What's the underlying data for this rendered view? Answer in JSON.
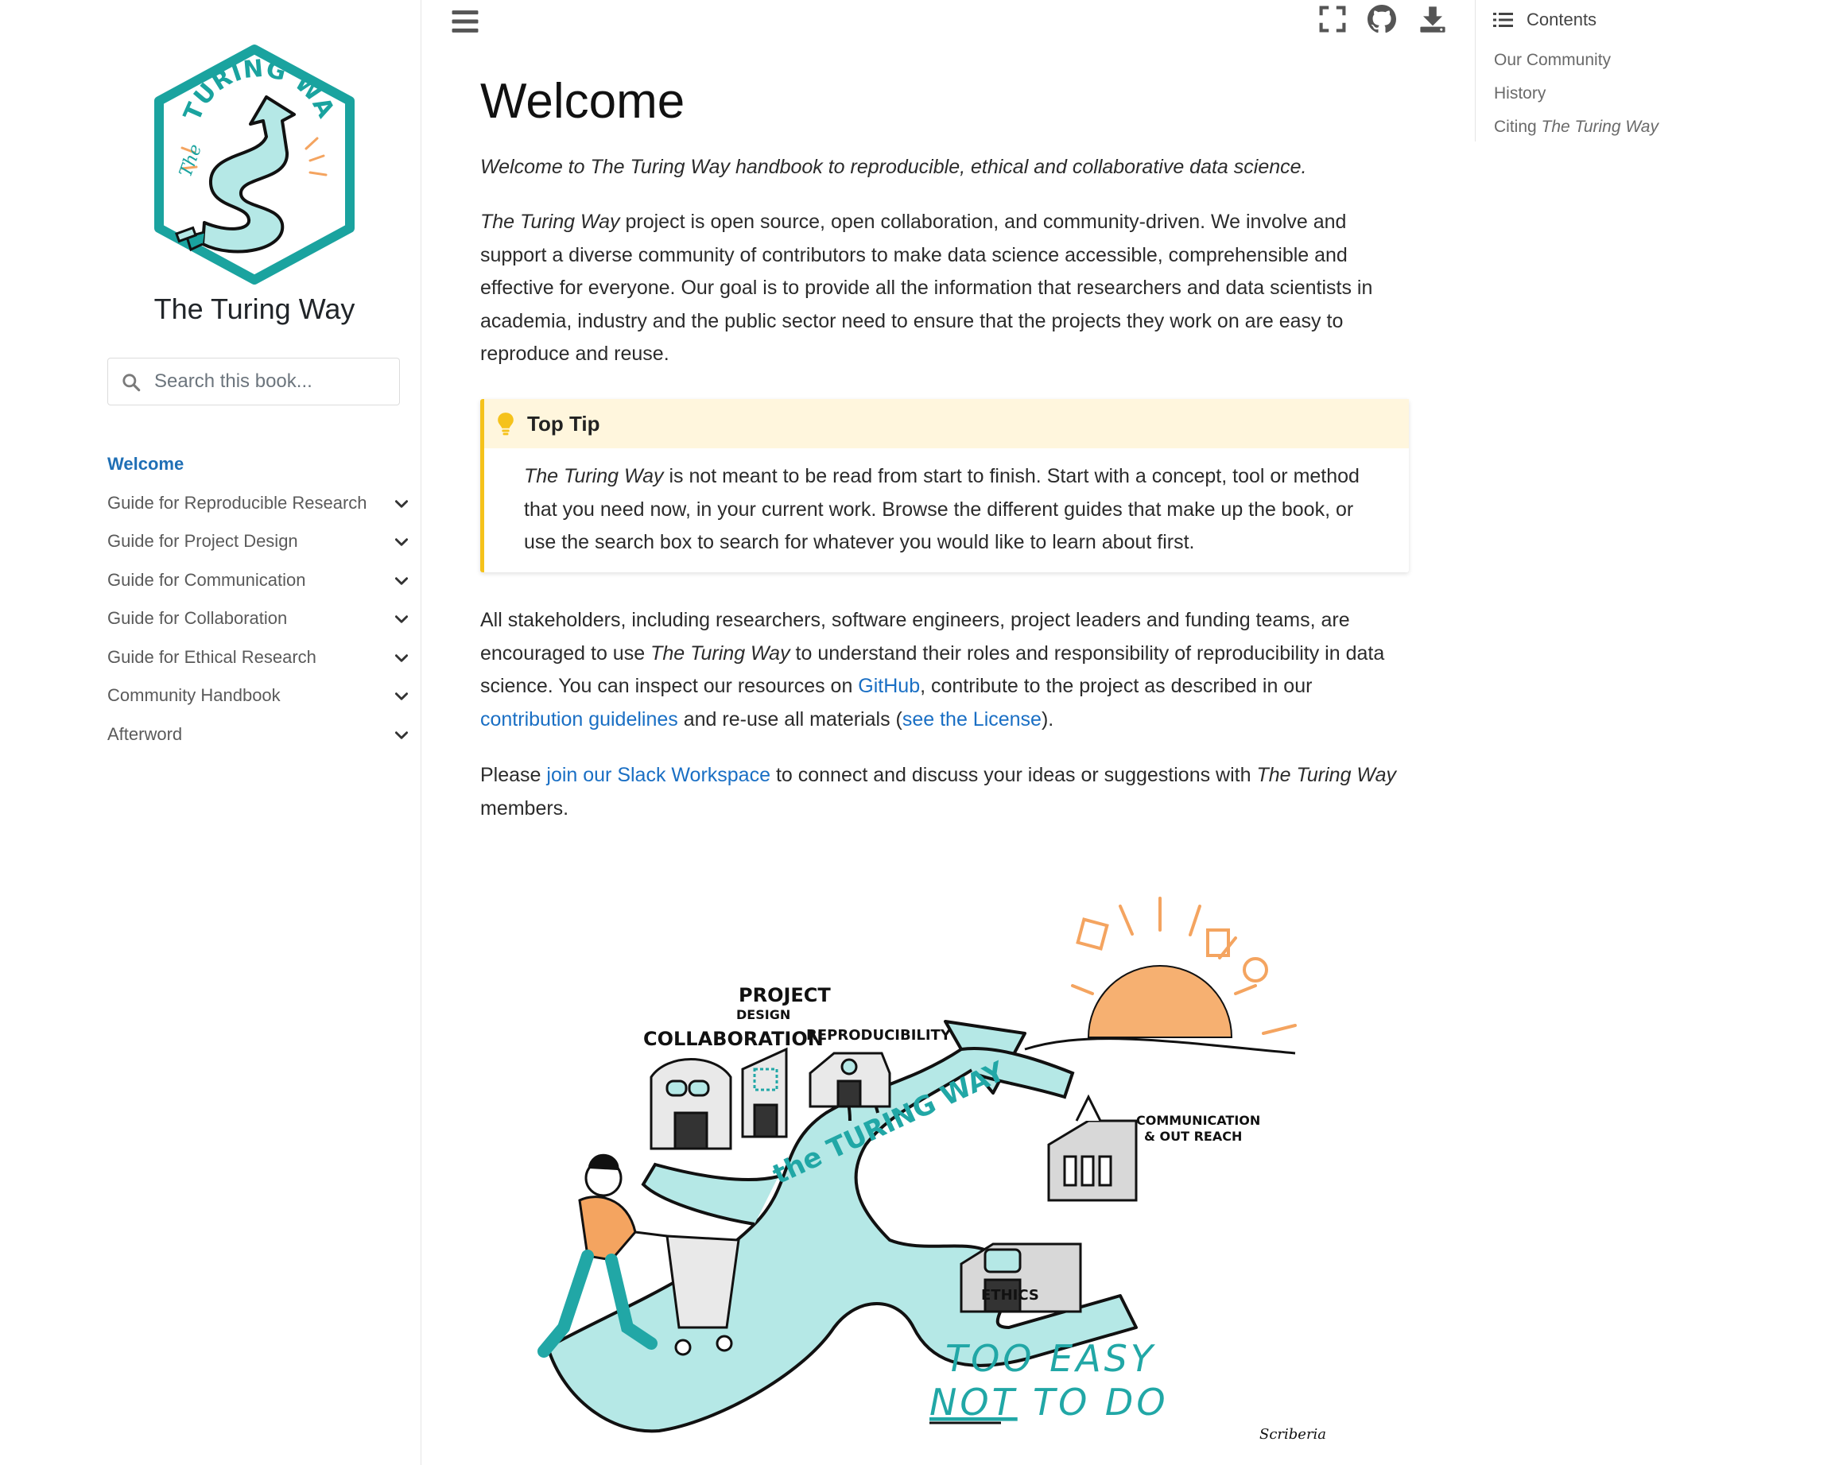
{
  "sidebar": {
    "site_title": "The Turing Way",
    "logo_alt": "The Turing Way",
    "search_placeholder": "Search this book...",
    "nav_items": [
      {
        "label": "Welcome",
        "active": true,
        "expandable": false
      },
      {
        "label": "Guide for Reproducible Research",
        "active": false,
        "expandable": true
      },
      {
        "label": "Guide for Project Design",
        "active": false,
        "expandable": true
      },
      {
        "label": "Guide for Communication",
        "active": false,
        "expandable": true
      },
      {
        "label": "Guide for Collaboration",
        "active": false,
        "expandable": true
      },
      {
        "label": "Guide for Ethical Research",
        "active": false,
        "expandable": true
      },
      {
        "label": "Community Handbook",
        "active": false,
        "expandable": true
      },
      {
        "label": "Afterword",
        "active": false,
        "expandable": true
      }
    ]
  },
  "topbar": {
    "icons": [
      "menu-icon",
      "fullscreen-icon",
      "github-icon",
      "download-icon"
    ]
  },
  "toc": {
    "header": "Contents",
    "items": [
      {
        "label": "Our Community"
      },
      {
        "label": "History"
      },
      {
        "label_prefix": "Citing ",
        "label_em": "The Turing Way"
      }
    ]
  },
  "main": {
    "title": "Welcome",
    "intro": "Welcome to The Turing Way handbook to reproducible, ethical and collaborative data science.",
    "about": {
      "em": "The Turing Way",
      "text": " project is open source, open collaboration, and community-driven. We involve and support a diverse community of contributors to make data science accessible, comprehensible and effective for everyone. Our goal is to provide all the information that researchers and data scientists in academia, industry and the public sector need to ensure that the projects they work on are easy to reproduce and reuse."
    },
    "admonition": {
      "title": "Top Tip",
      "em": "The Turing Way",
      "text": " is not meant to be read from start to finish. Start with a concept, tool or method that you need now, in your current work. Browse the different guides that make up the book, or use the search box to search for whatever you would like to learn about first."
    },
    "stakeholders": {
      "part1": "All stakeholders, including researchers, software engineers, project leaders and funding teams, are encouraged to use ",
      "em": "The Turing Way",
      "part2": " to understand their roles and responsibility of reproducibility in data science. You can inspect our resources on ",
      "github_link": "GitHub",
      "part3": ", contribute to the project as described in our ",
      "contrib_link": "contribution guidelines",
      "part4": " and re-use all materials (",
      "license_link": "see the License",
      "part5": ")."
    },
    "slack": {
      "part1": "Please ",
      "link": "join our Slack Workspace",
      "part2": " to connect and discuss your ideas or suggestions with ",
      "em": "The Turing Way",
      "part3": " members."
    },
    "illustration": {
      "labels": {
        "collaboration": "COLLABORATION",
        "project": "PROJECT",
        "design": "DESIGN",
        "reproducibility": "REPRODUCIBILITY",
        "communication": "COMMUNICATION",
        "outreach": "& OUT REACH",
        "ethics": "ETHICS",
        "road": "the TURING WAY",
        "slogan_1": "TOO EASY",
        "slogan_not": "NOT",
        "slogan_2": "TO DO",
        "signature": "Scriberia"
      }
    }
  },
  "colors": {
    "accent_link": "#1a6fc4",
    "teal": "#21a7a6",
    "teal_light": "#b5e8e6",
    "orange": "#f4a460",
    "admonition_border": "#f5c21b",
    "admonition_header_bg": "#fff6dd"
  }
}
